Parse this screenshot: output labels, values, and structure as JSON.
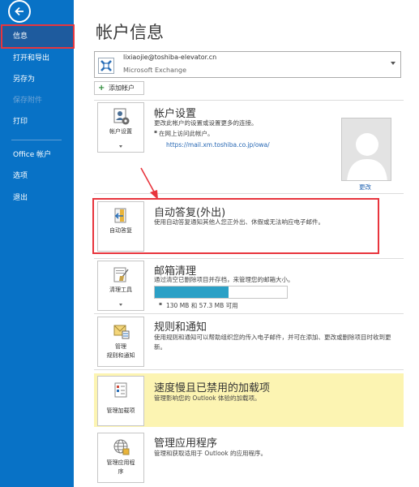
{
  "sidebar": {
    "items": [
      {
        "label": "信息",
        "selected": true
      },
      {
        "label": "打开和导出"
      },
      {
        "label": "另存为"
      },
      {
        "label": "保存附件",
        "disabled": true
      },
      {
        "label": "打印"
      },
      {
        "label": "Office 帐户"
      },
      {
        "label": "选项"
      },
      {
        "label": "退出"
      }
    ]
  },
  "main": {
    "title": "帐户信息",
    "account": {
      "email": "lixiaojie@toshiba-elevator.cn",
      "type": "Microsoft Exchange"
    },
    "add_account_label": "添加帐户",
    "sections": {
      "account_settings": {
        "tile_label": "帐户设置",
        "title": "帐户设置",
        "description": "更改此帐户的设置或设置更多的连接。",
        "bullet": "在网上访问此帐户。",
        "link": "https://mail.xm.toshiba.co.jp/owa/",
        "change_label": "更改"
      },
      "auto_reply": {
        "tile_label": "自动答复",
        "title": "自动答复(外出)",
        "description": "使用自动答复通知其他人您正外出、休假或无法响应电子邮件。"
      },
      "cleanup": {
        "tile_label": "清理工具",
        "title": "邮箱清理",
        "description": "通过清空已删除项目并存档，来管理您的邮箱大小。",
        "quota_text": "130 MB 和 57.3 MB 可用",
        "used_fraction": 0.56
      },
      "rules": {
        "tile_label_1": "管理",
        "tile_label_2": "规则和通知",
        "title": "规则和通知",
        "description": "使用规则和通知可以帮助组织您的传入电子邮件，并可在添加、更改或删除项目时收到更新。"
      },
      "addins": {
        "tile_label": "管理加载项",
        "title": "速度慢且已禁用的加载项",
        "description": "管理影响您的 Outlook 体验的加载项。"
      },
      "apps": {
        "tile_label_1": "管理应用程",
        "tile_label_2": "序",
        "title": "管理应用程序",
        "description": "管理和获取适用于 Outlook 的应用程序。"
      }
    }
  },
  "colors": {
    "sidebar_bg": "#0872c6",
    "selected_bg": "#1e5b9e",
    "annotation_red": "#e8353d",
    "highlight_yellow": "#fcf4b2",
    "progress_fill": "#2ba0c6",
    "link": "#2566b3"
  }
}
